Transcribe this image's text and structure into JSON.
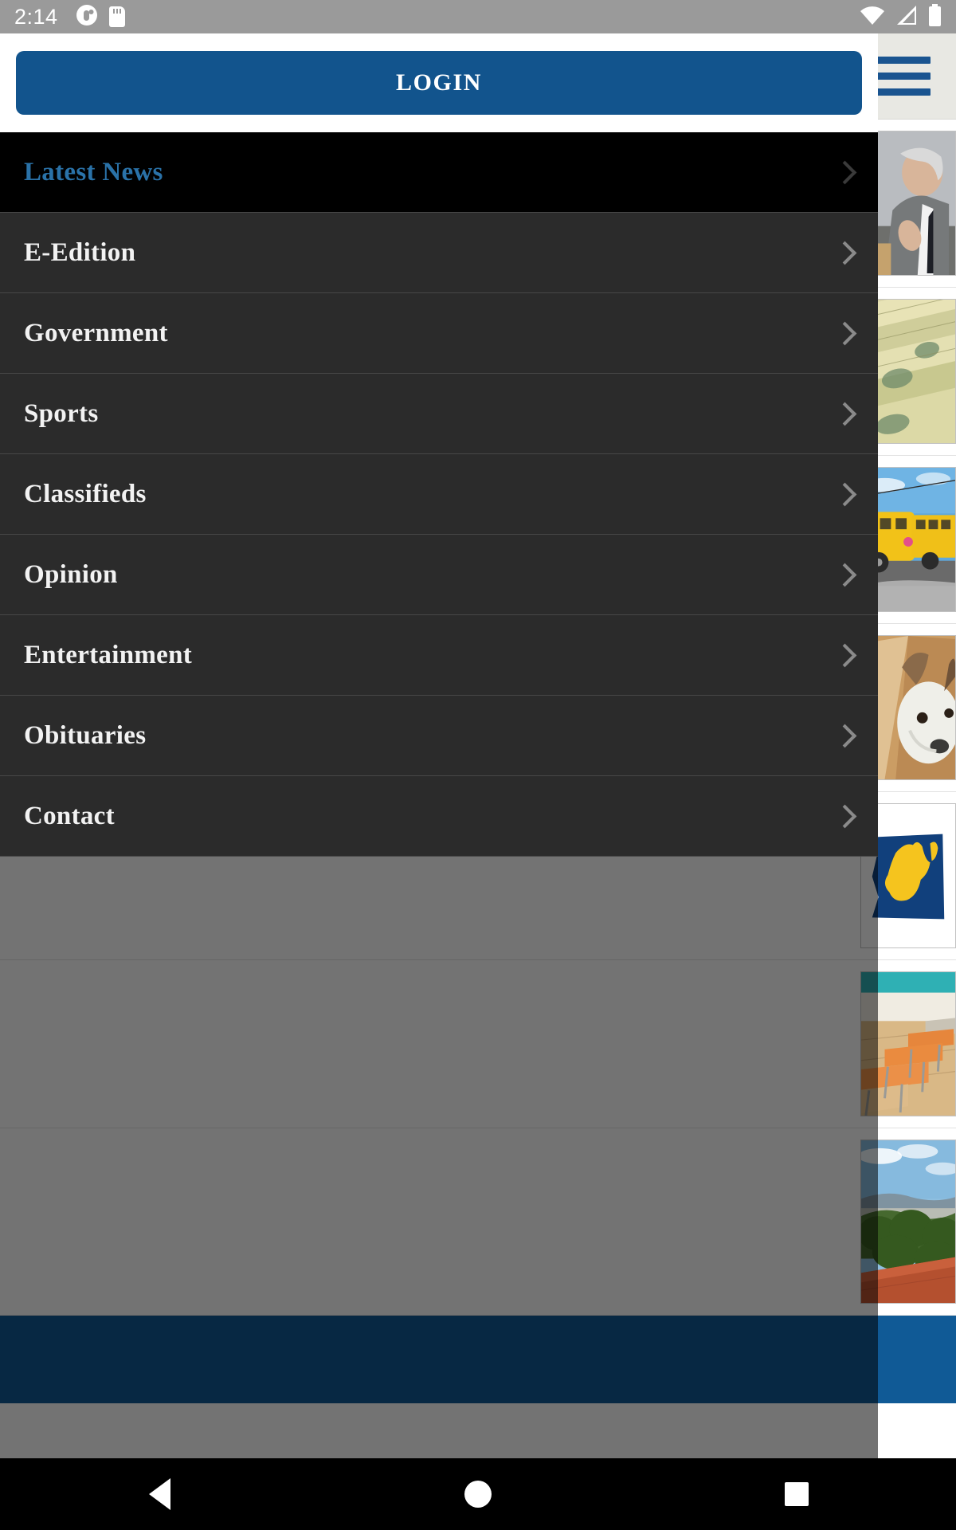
{
  "statusbar": {
    "time": "2:14",
    "icons": [
      "app-notification-icon",
      "sd-card-icon",
      "wifi-icon",
      "cellular-signal-icon",
      "battery-icon"
    ]
  },
  "drawer": {
    "login_label": "LOGIN",
    "items": [
      {
        "label": "Latest News",
        "active": true
      },
      {
        "label": "E-Edition",
        "active": false
      },
      {
        "label": "Government",
        "active": false
      },
      {
        "label": "Sports",
        "active": false
      },
      {
        "label": "Classifieds",
        "active": false
      },
      {
        "label": "Opinion",
        "active": false
      },
      {
        "label": "Entertainment",
        "active": false
      },
      {
        "label": "Obituaries",
        "active": false
      },
      {
        "label": "Contact",
        "active": false
      }
    ]
  },
  "page": {
    "menu_icon": "hamburger-menu-icon",
    "feed": [
      {
        "thumb": "man-in-gray-suit-photo"
      },
      {
        "thumb": "stack-of-cash-money-photo"
      },
      {
        "thumb": "yellow-school-buses-photo"
      },
      {
        "thumb": "small-dog-photo"
      },
      {
        "thumb": "west-virginia-state-map-logo"
      },
      {
        "thumb": "classroom-desks-photo"
      },
      {
        "thumb": "hillside-landscape-brick-wall-photo"
      }
    ]
  },
  "navbar": {
    "buttons": [
      "back-button",
      "home-button",
      "recents-button"
    ]
  },
  "colors": {
    "accent_blue": "#12548d",
    "active_link_blue": "#2a72a8",
    "menu_bg": "#2b2b2b",
    "active_menu_bg": "#000000",
    "statusbar_bg": "#9a9a9a",
    "scrim": "#5c5c5c",
    "header_bg": "#e8e8e3"
  }
}
